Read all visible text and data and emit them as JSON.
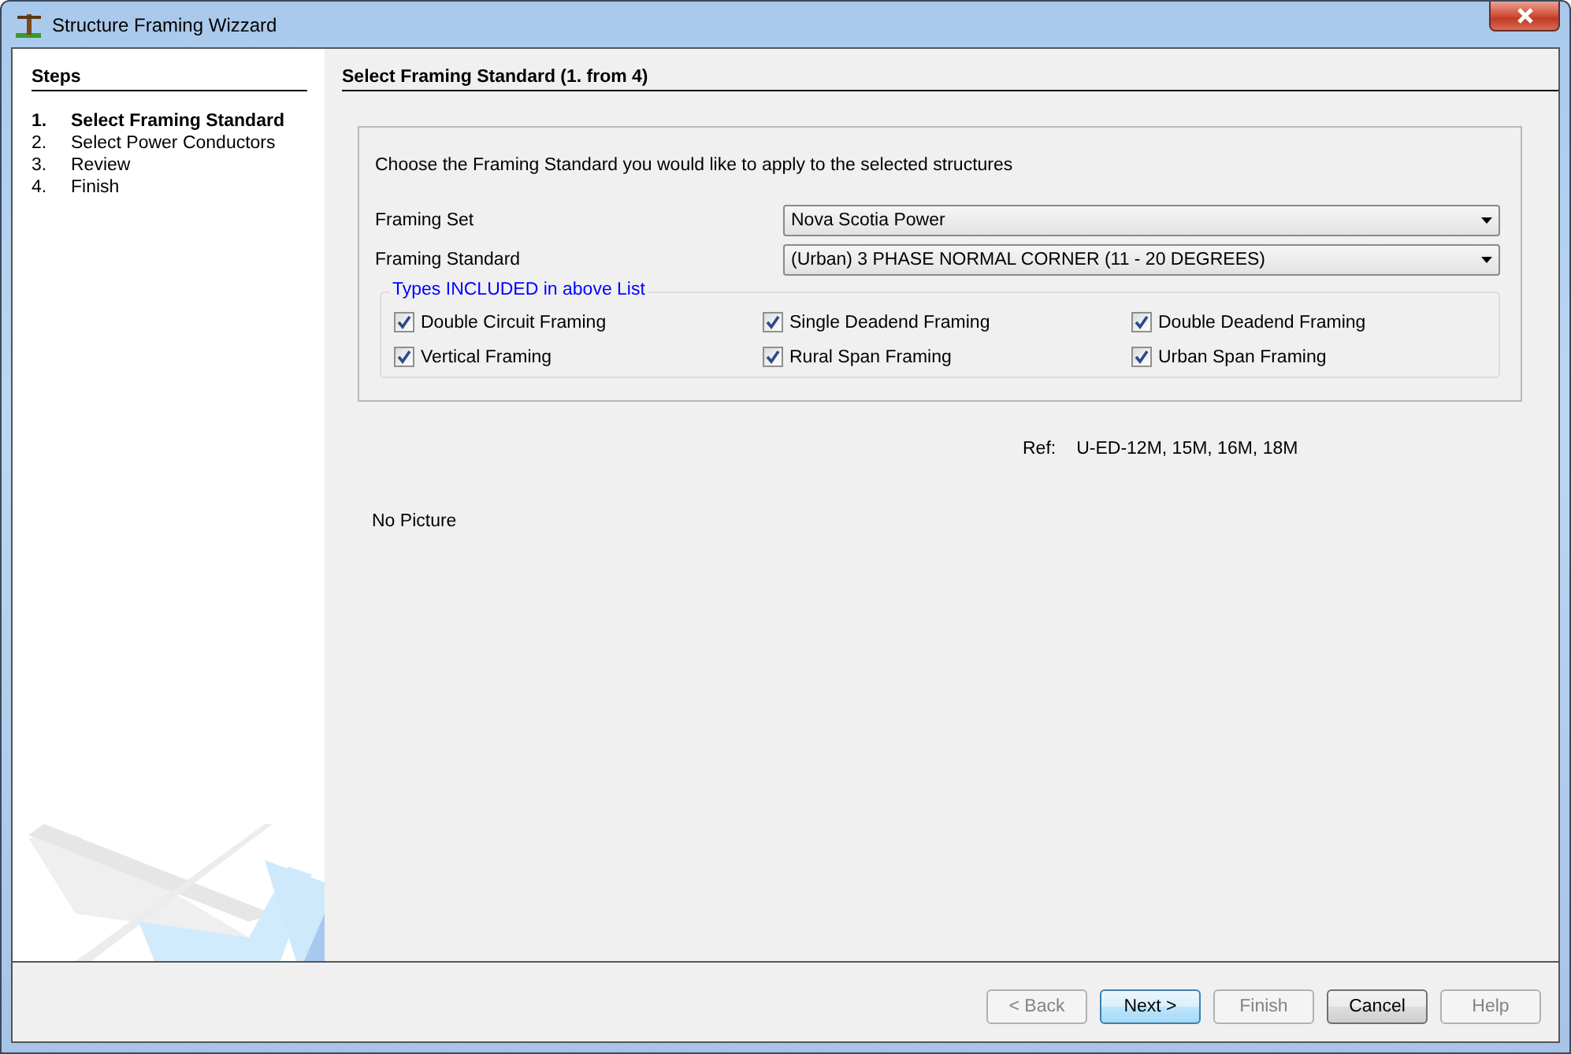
{
  "window": {
    "title": "Structure Framing Wizzard"
  },
  "sidebar": {
    "heading": "Steps",
    "steps": [
      {
        "number": "1.",
        "label": "Select Framing Standard",
        "selected": true
      },
      {
        "number": "2.",
        "label": "Select Power Conductors",
        "selected": false
      },
      {
        "number": "3.",
        "label": "Review",
        "selected": false
      },
      {
        "number": "4.",
        "label": "Finish",
        "selected": false
      }
    ]
  },
  "main": {
    "heading": "Select Framing Standard (1. from 4)",
    "instruction": "Choose the Framing Standard you would like to apply to the selected structures",
    "fields": [
      {
        "label": "Framing Set",
        "value": "Nova Scotia Power"
      },
      {
        "label": "Framing Standard",
        "value": "(Urban) 3 PHASE NORMAL CORNER (11 - 20 DEGREES)"
      }
    ],
    "types_group": {
      "title": "Types INCLUDED in above List",
      "items": [
        {
          "label": "Double Circuit Framing",
          "checked": true
        },
        {
          "label": "Single Deadend Framing",
          "checked": true
        },
        {
          "label": "Double Deadend Framing",
          "checked": true
        },
        {
          "label": "Vertical Framing",
          "checked": true
        },
        {
          "label": "Rural Span Framing",
          "checked": true
        },
        {
          "label": "Urban Span Framing",
          "checked": true
        }
      ]
    },
    "ref_label": "Ref:",
    "ref_value": "U-ED-12M, 15M, 16M, 18M",
    "picture_text": "No Picture"
  },
  "buttons": [
    {
      "label": "< Back",
      "disabled": true,
      "default": false
    },
    {
      "label": "Next >",
      "disabled": false,
      "default": true
    },
    {
      "label": "Finish",
      "disabled": true,
      "default": false
    },
    {
      "label": "Cancel",
      "disabled": false,
      "default": false
    },
    {
      "label": "Help",
      "disabled": true,
      "default": false
    }
  ]
}
